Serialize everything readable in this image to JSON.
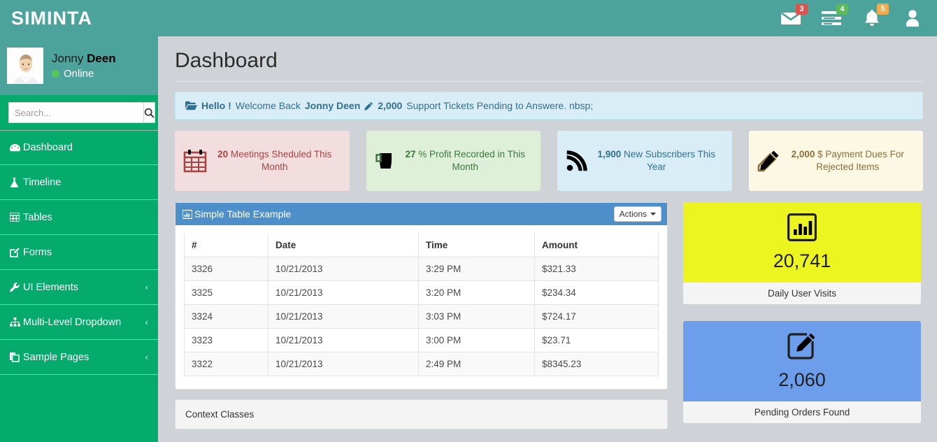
{
  "header": {
    "brand": "SIMINTA",
    "icons": [
      {
        "name": "messages",
        "icon": "envelope-icon",
        "badge": "3",
        "badge_color": "#d9534f"
      },
      {
        "name": "tasks",
        "icon": "tasks-icon",
        "badge": "4",
        "badge_color": "#5cb85c"
      },
      {
        "name": "notifications",
        "icon": "bell-icon",
        "badge": "5",
        "badge_color": "#f0ad4e"
      },
      {
        "name": "user",
        "icon": "user-icon",
        "badge": "",
        "badge_color": ""
      }
    ]
  },
  "sidebar": {
    "user": {
      "name_first": "Jonny ",
      "name_last": "Deen",
      "status": "Online"
    },
    "search": {
      "placeholder": "Search...",
      "value": "",
      "button_icon": "search-icon"
    },
    "items": [
      {
        "label": "Dashboard",
        "icon": "dashboard-icon",
        "caret": "",
        "active": true
      },
      {
        "label": "Timeline",
        "icon": "flask-icon",
        "caret": ""
      },
      {
        "label": "Tables",
        "icon": "table-icon",
        "caret": ""
      },
      {
        "label": "Forms",
        "icon": "edit-icon",
        "caret": ""
      },
      {
        "label": "UI Elements",
        "icon": "wrench-icon",
        "caret": "‹"
      },
      {
        "label": "Multi-Level Dropdown",
        "icon": "sitemap-icon",
        "caret": "‹"
      },
      {
        "label": "Sample Pages",
        "icon": "copy-icon",
        "caret": "‹"
      }
    ]
  },
  "main": {
    "page_title": "Dashboard",
    "alert": {
      "icon": "folder-open-icon",
      "hello": "Hello !",
      "welcome": " Welcome Back ",
      "user": "Jonny Deen",
      "pencil_icon": "pencil-icon",
      "count": "2,000",
      "tail": " Support Tickets Pending to Answere. nbsp;"
    },
    "stats": [
      {
        "icon": "calendar-icon",
        "value": "20",
        "text": " Meetings Sheduled This Month",
        "bg": "#f2dede",
        "fg": "#a94442"
      },
      {
        "icon": "mug-icon",
        "value": "27",
        "text": " % Profit Recorded in This Month",
        "bg": "#dff0d8",
        "fg": "#3c763d"
      },
      {
        "icon": "rss-icon",
        "value": "1,900",
        "text": " New Subscribers This Year",
        "bg": "#d9edf7",
        "fg": "#31708f"
      },
      {
        "icon": "pencil-icon",
        "value": "2,000",
        "text": " $ Payment Dues For Rejected Items",
        "bg": "#fcf8e3",
        "fg": "#8a6d3b"
      }
    ],
    "table_panel": {
      "icon": "bar-chart-icon",
      "title": "Simple Table Example",
      "actions_label": "Actions",
      "columns": [
        "#",
        "Date",
        "Time",
        "Amount"
      ],
      "rows": [
        [
          "3326",
          "10/21/2013",
          "3:29 PM",
          "$321.33"
        ],
        [
          "3325",
          "10/21/2013",
          "3:20 PM",
          "$234.34"
        ],
        [
          "3324",
          "10/21/2013",
          "3:03 PM",
          "$724.17"
        ],
        [
          "3323",
          "10/21/2013",
          "3:00 PM",
          "$23.71"
        ],
        [
          "3322",
          "10/21/2013",
          "2:49 PM",
          "$8345.23"
        ]
      ]
    },
    "context_panel": {
      "title": "Context Classes"
    },
    "widgets": [
      {
        "icon": "bar-chart-box-icon",
        "number": "20,741",
        "label": "Daily User Visits",
        "bg": "#edf520"
      },
      {
        "icon": "edit-square-icon",
        "number": "2,060",
        "label": "Pending Orders Found",
        "bg": "#6d9eeb"
      }
    ]
  }
}
